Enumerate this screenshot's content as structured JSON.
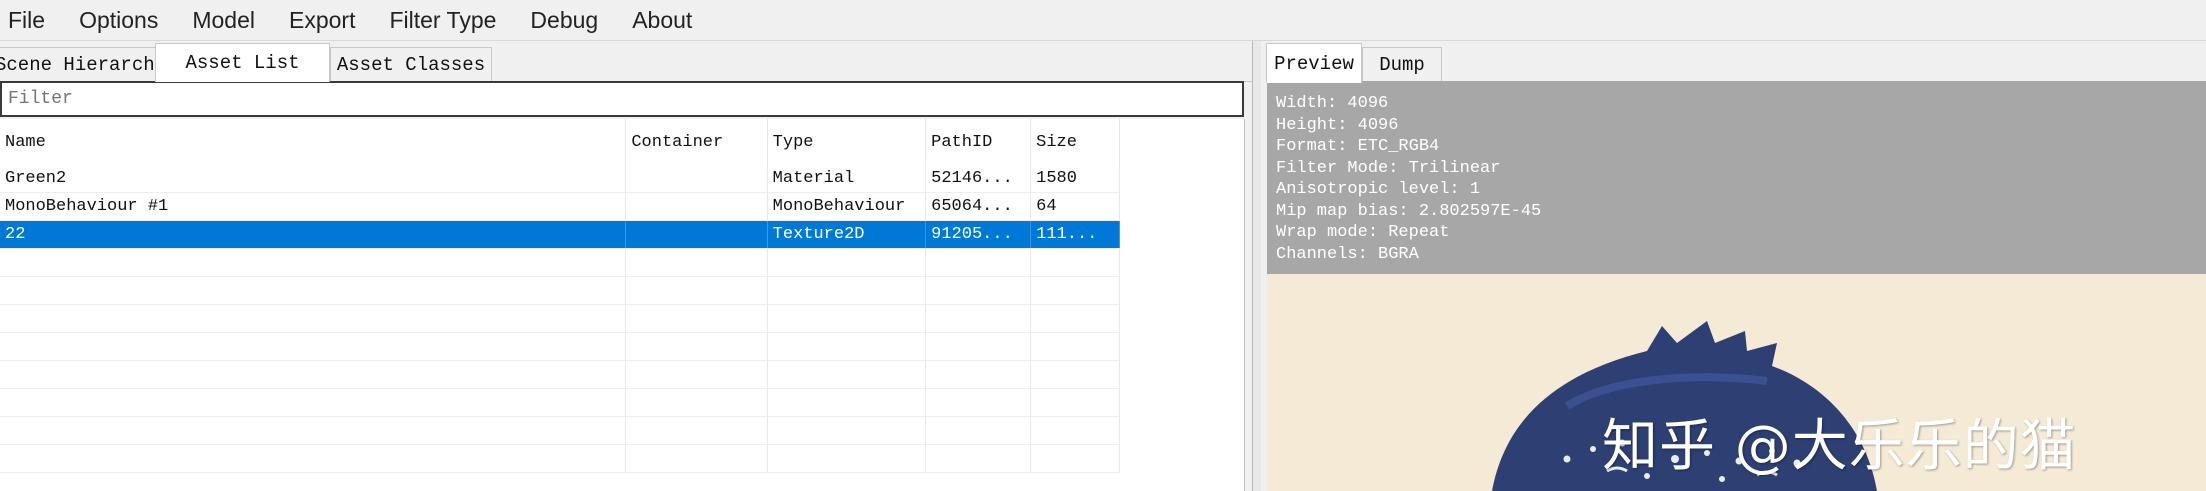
{
  "menu": [
    "File",
    "Options",
    "Model",
    "Export",
    "Filter Type",
    "Debug",
    "About"
  ],
  "left_tabs": {
    "scene": "Scene Hierarchy",
    "assets": "Asset List",
    "classes": "Asset Classes"
  },
  "filter": {
    "placeholder": "Filter",
    "value": ""
  },
  "table": {
    "headers": {
      "name": "Name",
      "container": "Container",
      "type": "Type",
      "path": "PathID",
      "size": "Size"
    },
    "rows": [
      {
        "name": "Green2",
        "container": "",
        "type": "Material",
        "path": "52146...",
        "size": "1580"
      },
      {
        "name": "MonoBehaviour #1",
        "container": "",
        "type": "MonoBehaviour",
        "path": "65064...",
        "size": "64"
      },
      {
        "name": "22",
        "container": "",
        "type": "Texture2D",
        "path": "91205...",
        "size": "111..."
      }
    ]
  },
  "right_tabs": {
    "preview": "Preview",
    "dump": "Dump"
  },
  "info": [
    "Width: 4096",
    "Height: 4096",
    "Format: ETC_RGB4",
    "Filter Mode: Trilinear",
    "Anisotropic level: 1",
    "Mip map bias: 2.802597E-45",
    "Wrap mode: Repeat",
    "Channels: BGRA"
  ],
  "watermark": "知乎 @大乐乐的猫",
  "colors": {
    "selection": "#0078d7",
    "info_bg": "#a7a7a7",
    "preview_bg": "#f5ead6",
    "texture_blue": "#2d3f73"
  }
}
